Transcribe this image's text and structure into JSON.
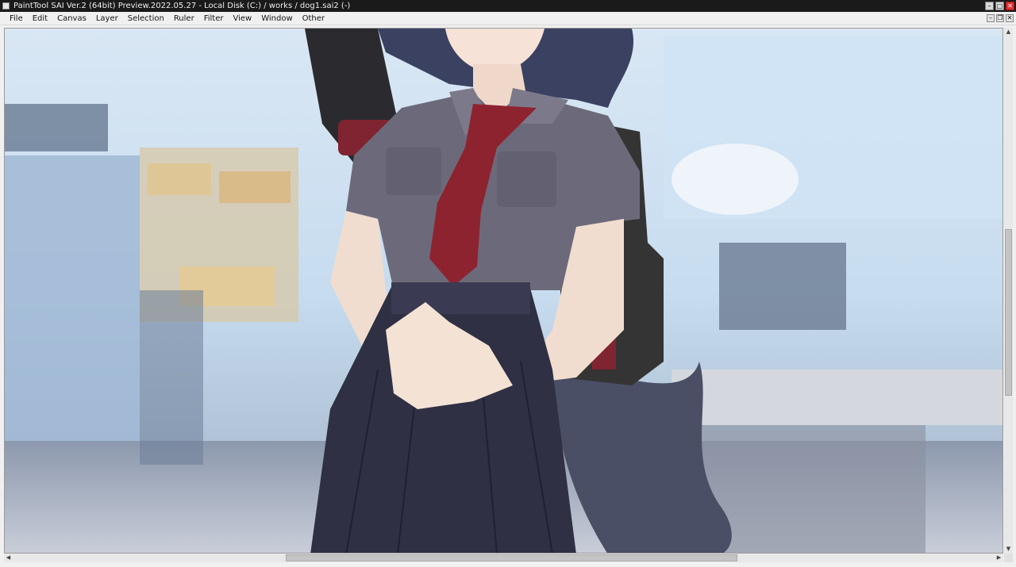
{
  "window": {
    "title": "PaintTool SAI Ver.2 (64bit) Preview.2022.05.27 - Local Disk (C:) / works / dog1.sai2 (-)",
    "buttons": {
      "minimize": "–",
      "maximize": "□",
      "close": "✕"
    }
  },
  "menu": {
    "items": [
      "File",
      "Edit",
      "Canvas",
      "Layer",
      "Selection",
      "Ruler",
      "Filter",
      "View",
      "Window",
      "Other"
    ],
    "doc_buttons": {
      "minimize": "–",
      "restore": "❐",
      "close": "✕"
    }
  },
  "canvas": {
    "description_icon": "artwork-canvas",
    "colors": {
      "sky": "#bcd6ee",
      "shirt": "#6c6a7a",
      "tie": "#8e2330",
      "skirt": "#2f3044",
      "skin": "#f1ddcf",
      "hair": "#3b4160",
      "bag": "#343434"
    }
  },
  "scrollbars": {
    "arrow_up": "▲",
    "arrow_down": "▼",
    "arrow_left": "◀",
    "arrow_right": "▶"
  }
}
